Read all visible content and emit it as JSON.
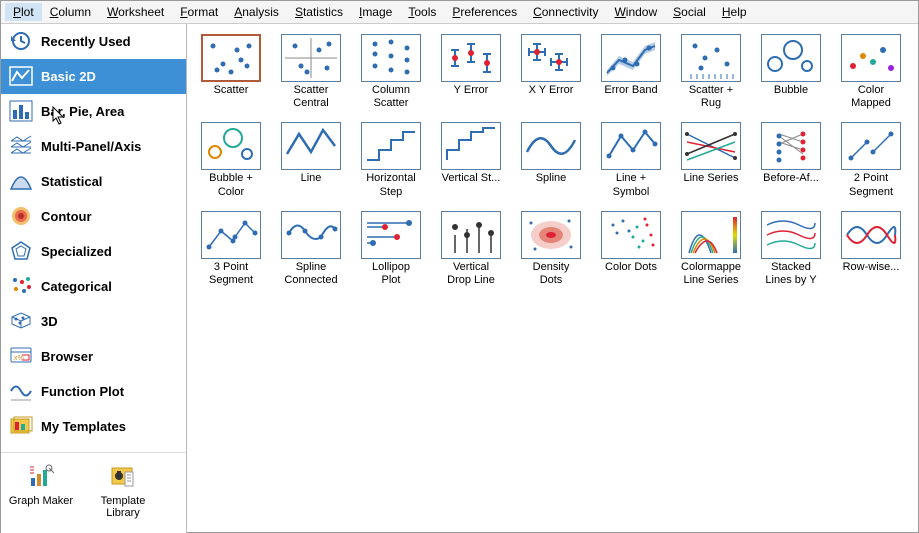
{
  "menu": [
    {
      "label": "Plot",
      "active": true
    },
    {
      "label": "Column"
    },
    {
      "label": "Worksheet"
    },
    {
      "label": "Format"
    },
    {
      "label": "Analysis"
    },
    {
      "label": "Statistics"
    },
    {
      "label": "Image"
    },
    {
      "label": "Tools"
    },
    {
      "label": "Preferences"
    },
    {
      "label": "Connectivity"
    },
    {
      "label": "Window"
    },
    {
      "label": "Social"
    },
    {
      "label": "Help"
    }
  ],
  "sidebar": [
    {
      "id": "recent",
      "label": "Recently Used"
    },
    {
      "id": "basic2d",
      "label": "Basic 2D",
      "selected": true
    },
    {
      "id": "barpie",
      "label": "Bar, Pie, Area"
    },
    {
      "id": "multipanel",
      "label": "Multi-Panel/Axis"
    },
    {
      "id": "statistical",
      "label": "Statistical"
    },
    {
      "id": "contour",
      "label": "Contour"
    },
    {
      "id": "specialized",
      "label": "Specialized"
    },
    {
      "id": "categorical",
      "label": "Categorical"
    },
    {
      "id": "3d",
      "label": "3D"
    },
    {
      "id": "browser",
      "label": "Browser"
    },
    {
      "id": "functionplot",
      "label": "Function Plot"
    },
    {
      "id": "mytemplates",
      "label": "My Templates"
    }
  ],
  "bottom": [
    {
      "id": "graphmaker",
      "label": "Graph Maker"
    },
    {
      "id": "templatelib",
      "label": "Template\nLibrary"
    }
  ],
  "plots": [
    {
      "id": "scatter",
      "label": "Scatter",
      "selected": true
    },
    {
      "id": "scatter-central",
      "label": "Scatter\nCentral"
    },
    {
      "id": "column-scatter",
      "label": "Column\nScatter"
    },
    {
      "id": "y-error",
      "label": "Y Error"
    },
    {
      "id": "xy-error",
      "label": "X Y Error"
    },
    {
      "id": "error-band",
      "label": "Error Band"
    },
    {
      "id": "scatter-rug",
      "label": "Scatter +\nRug"
    },
    {
      "id": "bubble",
      "label": "Bubble"
    },
    {
      "id": "color-mapped",
      "label": "Color\nMapped"
    },
    {
      "id": "bubble-color",
      "label": "Bubble +\nColor"
    },
    {
      "id": "line",
      "label": "Line"
    },
    {
      "id": "hstep",
      "label": "Horizontal\nStep"
    },
    {
      "id": "vstep",
      "label": "Vertical St..."
    },
    {
      "id": "spline",
      "label": "Spline"
    },
    {
      "id": "line-symbol",
      "label": "Line +\nSymbol"
    },
    {
      "id": "line-series",
      "label": "Line Series"
    },
    {
      "id": "before-after",
      "label": "Before-Af..."
    },
    {
      "id": "2pt",
      "label": "2 Point\nSegment"
    },
    {
      "id": "3pt",
      "label": "3 Point\nSegment"
    },
    {
      "id": "spline-connected",
      "label": "Spline\nConnected"
    },
    {
      "id": "lollipop",
      "label": "Lollipop\nPlot"
    },
    {
      "id": "vdrop",
      "label": "Vertical\nDrop Line"
    },
    {
      "id": "density",
      "label": "Density\nDots"
    },
    {
      "id": "color-dots",
      "label": "Color Dots"
    },
    {
      "id": "cm-line-series",
      "label": "Colormappe\nLine Series"
    },
    {
      "id": "stacked-lines",
      "label": "Stacked\nLines by Y"
    },
    {
      "id": "row-wise",
      "label": "Row-wise..."
    }
  ]
}
